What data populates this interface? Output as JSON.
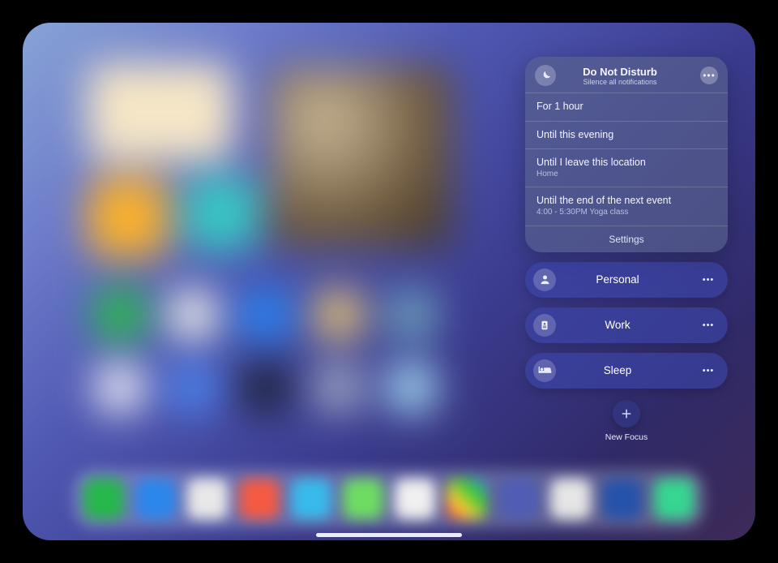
{
  "dnd": {
    "title": "Do Not Disturb",
    "subtitle": "Silence all notifications",
    "options": [
      {
        "label": "For 1 hour"
      },
      {
        "label": "Until this evening"
      },
      {
        "label": "Until I leave this location",
        "sub": "Home"
      },
      {
        "label": "Until the end of the next event",
        "sub": "4:00 - 5:30PM Yoga class"
      }
    ],
    "settings_label": "Settings"
  },
  "focus_modes": [
    {
      "id": "personal",
      "label": "Personal",
      "icon": "person"
    },
    {
      "id": "work",
      "label": "Work",
      "icon": "badge"
    },
    {
      "id": "sleep",
      "label": "Sleep",
      "icon": "bed"
    }
  ],
  "new_focus_label": "New Focus"
}
